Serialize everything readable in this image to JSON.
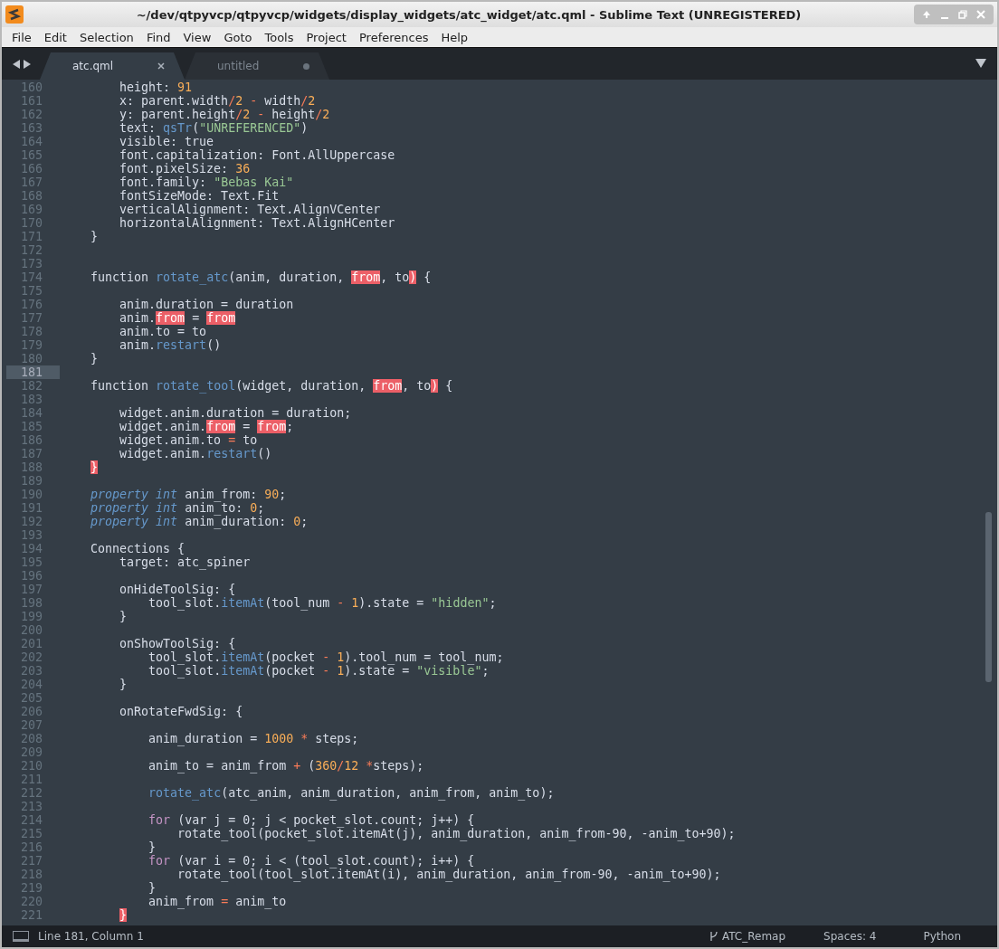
{
  "window": {
    "title": "~/dev/qtpyvcp/qtpyvcp/widgets/display_widgets/atc_widget/atc.qml - Sublime Text (UNREGISTERED)"
  },
  "menu": [
    "File",
    "Edit",
    "Selection",
    "Find",
    "View",
    "Goto",
    "Tools",
    "Project",
    "Preferences",
    "Help"
  ],
  "tabs": [
    {
      "label": "atc.qml",
      "selected": true,
      "modified": false
    },
    {
      "label": "untitled",
      "selected": false,
      "modified": true
    }
  ],
  "lines": [
    {
      "number": "160",
      "selected": false,
      "tokens": [
        {
          "text": "        height: ",
          "kind": "plain"
        },
        {
          "text": "91",
          "kind": "number"
        }
      ]
    },
    {
      "number": "161",
      "selected": false,
      "tokens": [
        {
          "text": "        x: parent.width",
          "kind": "plain"
        },
        {
          "text": "/",
          "kind": "operator"
        },
        {
          "text": "2",
          "kind": "number"
        },
        {
          "text": " -",
          "kind": "operator"
        },
        {
          "text": " width",
          "kind": "plain"
        },
        {
          "text": "/",
          "kind": "operator"
        },
        {
          "text": "2",
          "kind": "number"
        }
      ]
    },
    {
      "number": "162",
      "selected": false,
      "tokens": [
        {
          "text": "        y: parent.height",
          "kind": "plain"
        },
        {
          "text": "/",
          "kind": "operator"
        },
        {
          "text": "2",
          "kind": "number"
        },
        {
          "text": " -",
          "kind": "operator"
        },
        {
          "text": " height",
          "kind": "plain"
        },
        {
          "text": "/",
          "kind": "operator"
        },
        {
          "text": "2",
          "kind": "number"
        }
      ]
    },
    {
      "number": "163",
      "selected": false,
      "tokens": [
        {
          "text": "        text: ",
          "kind": "plain"
        },
        {
          "text": "qsTr",
          "kind": "func"
        },
        {
          "text": "(",
          "kind": "plain"
        },
        {
          "text": "\"UNREFERENCED\"",
          "kind": "string"
        },
        {
          "text": ")",
          "kind": "plain"
        }
      ]
    },
    {
      "number": "164",
      "selected": false,
      "tokens": [
        {
          "text": "        visible: true",
          "kind": "plain"
        }
      ]
    },
    {
      "number": "165",
      "selected": false,
      "tokens": [
        {
          "text": "        font.capitalization: Font.AllUppercase",
          "kind": "plain"
        }
      ]
    },
    {
      "number": "166",
      "selected": false,
      "tokens": [
        {
          "text": "        font.pixelSize: ",
          "kind": "plain"
        },
        {
          "text": "36",
          "kind": "number"
        }
      ]
    },
    {
      "number": "167",
      "selected": false,
      "tokens": [
        {
          "text": "        font.family: ",
          "kind": "plain"
        },
        {
          "text": "\"Bebas Kai\"",
          "kind": "string"
        }
      ]
    },
    {
      "number": "168",
      "selected": false,
      "tokens": [
        {
          "text": "        fontSizeMode: Text.Fit",
          "kind": "plain"
        }
      ]
    },
    {
      "number": "169",
      "selected": false,
      "tokens": [
        {
          "text": "        verticalAlignment: Text.AlignVCenter",
          "kind": "plain"
        }
      ]
    },
    {
      "number": "170",
      "selected": false,
      "tokens": [
        {
          "text": "        horizontalAlignment: Text.AlignHCenter",
          "kind": "plain"
        }
      ]
    },
    {
      "number": "171",
      "selected": false,
      "tokens": [
        {
          "text": "    }",
          "kind": "plain"
        }
      ]
    },
    {
      "number": "172",
      "selected": false
    },
    {
      "number": "173",
      "selected": false
    },
    {
      "number": "174",
      "selected": false,
      "tokens": [
        {
          "text": "    function ",
          "kind": "plain"
        },
        {
          "text": "rotate_atc",
          "kind": "func"
        },
        {
          "text": "(anim, duration, ",
          "kind": "plain"
        },
        {
          "text": "from",
          "kind": "invalid"
        },
        {
          "text": ", to",
          "kind": "plain"
        },
        {
          "text": ")",
          "kind": "invalid"
        },
        {
          "text": " {",
          "kind": "plain"
        }
      ]
    },
    {
      "number": "175",
      "selected": false
    },
    {
      "number": "176",
      "selected": false,
      "tokens": [
        {
          "text": "        anim.duration = duration",
          "kind": "plain"
        }
      ]
    },
    {
      "number": "177",
      "selected": false,
      "tokens": [
        {
          "text": "        anim.",
          "kind": "plain"
        },
        {
          "text": "from",
          "kind": "invalid"
        },
        {
          "text": " = ",
          "kind": "plain"
        },
        {
          "text": "from",
          "kind": "invalid"
        }
      ]
    },
    {
      "number": "178",
      "selected": false,
      "tokens": [
        {
          "text": "        anim.to = to",
          "kind": "plain"
        }
      ]
    },
    {
      "number": "179",
      "selected": false,
      "tokens": [
        {
          "text": "        anim.",
          "kind": "plain"
        },
        {
          "text": "restart",
          "kind": "func"
        },
        {
          "text": "()",
          "kind": "plain"
        }
      ]
    },
    {
      "number": "180",
      "selected": false,
      "tokens": [
        {
          "text": "    }",
          "kind": "plain"
        }
      ]
    },
    {
      "number": "181",
      "selected": true
    },
    {
      "number": "182",
      "selected": false,
      "tokens": [
        {
          "text": "    function ",
          "kind": "plain"
        },
        {
          "text": "rotate_tool",
          "kind": "func"
        },
        {
          "text": "(widget, duration, ",
          "kind": "plain"
        },
        {
          "text": "from",
          "kind": "invalid"
        },
        {
          "text": ", to",
          "kind": "plain"
        },
        {
          "text": ")",
          "kind": "invalid"
        },
        {
          "text": " {",
          "kind": "plain"
        }
      ]
    },
    {
      "number": "183",
      "selected": false
    },
    {
      "number": "184",
      "selected": false,
      "tokens": [
        {
          "text": "        widget.anim.duration = duration;",
          "kind": "plain"
        }
      ]
    },
    {
      "number": "185",
      "selected": false,
      "tokens": [
        {
          "text": "        widget.anim.",
          "kind": "plain"
        },
        {
          "text": "from",
          "kind": "invalid"
        },
        {
          "text": " = ",
          "kind": "plain"
        },
        {
          "text": "from",
          "kind": "invalid"
        },
        {
          "text": ";",
          "kind": "plain"
        }
      ]
    },
    {
      "number": "186",
      "selected": false,
      "tokens": [
        {
          "text": "        widget.anim.to ",
          "kind": "plain"
        },
        {
          "text": "=",
          "kind": "operator"
        },
        {
          "text": " to",
          "kind": "plain"
        }
      ]
    },
    {
      "number": "187",
      "selected": false,
      "tokens": [
        {
          "text": "        widget.anim.",
          "kind": "plain"
        },
        {
          "text": "restart",
          "kind": "func"
        },
        {
          "text": "()",
          "kind": "plain"
        }
      ]
    },
    {
      "number": "188",
      "selected": false,
      "tokens": [
        {
          "text": "    }",
          "kind": "invalid"
        }
      ]
    },
    {
      "number": "189",
      "selected": false
    },
    {
      "number": "190",
      "selected": false,
      "tokens": [
        {
          "text": "    property int",
          "kind": "storage"
        },
        {
          "text": " anim_from: ",
          "kind": "plain"
        },
        {
          "text": "90",
          "kind": "number"
        },
        {
          "text": ";",
          "kind": "plain"
        }
      ]
    },
    {
      "number": "191",
      "selected": false,
      "tokens": [
        {
          "text": "    property int",
          "kind": "storage"
        },
        {
          "text": " anim_to: ",
          "kind": "plain"
        },
        {
          "text": "0",
          "kind": "number"
        },
        {
          "text": ";",
          "kind": "plain"
        }
      ]
    },
    {
      "number": "192",
      "selected": false,
      "tokens": [
        {
          "text": "    property int",
          "kind": "storage"
        },
        {
          "text": " anim_duration: ",
          "kind": "plain"
        },
        {
          "text": "0",
          "kind": "number"
        },
        {
          "text": ";",
          "kind": "plain"
        }
      ]
    },
    {
      "number": "193",
      "selected": false
    },
    {
      "number": "194",
      "selected": false,
      "tokens": [
        {
          "text": "    Connections {",
          "kind": "plain"
        }
      ]
    },
    {
      "number": "195",
      "selected": false,
      "tokens": [
        {
          "text": "        target: atc_spiner",
          "kind": "plain"
        }
      ]
    },
    {
      "number": "196",
      "selected": false
    },
    {
      "number": "197",
      "selected": false,
      "tokens": [
        {
          "text": "        onHideToolSig: {",
          "kind": "plain"
        }
      ]
    },
    {
      "number": "198",
      "selected": false,
      "tokens": [
        {
          "text": "            tool_slot.",
          "kind": "plain"
        },
        {
          "text": "itemAt",
          "kind": "func"
        },
        {
          "text": "(tool_num ",
          "kind": "plain"
        },
        {
          "text": "-",
          "kind": "operator"
        },
        {
          "text": " 1",
          "kind": "number"
        },
        {
          "text": ").state = ",
          "kind": "plain"
        },
        {
          "text": "\"hidden\"",
          "kind": "string"
        },
        {
          "text": ";",
          "kind": "plain"
        }
      ]
    },
    {
      "number": "199",
      "selected": false,
      "tokens": [
        {
          "text": "        }",
          "kind": "plain"
        }
      ]
    },
    {
      "number": "200",
      "selected": false
    },
    {
      "number": "201",
      "selected": false,
      "tokens": [
        {
          "text": "        onShowToolSig: {",
          "kind": "plain"
        }
      ]
    },
    {
      "number": "202",
      "selected": false,
      "tokens": [
        {
          "text": "            tool_slot.",
          "kind": "plain"
        },
        {
          "text": "itemAt",
          "kind": "func"
        },
        {
          "text": "(pocket ",
          "kind": "plain"
        },
        {
          "text": "-",
          "kind": "operator"
        },
        {
          "text": " 1",
          "kind": "number"
        },
        {
          "text": ").tool_num = tool_num;",
          "kind": "plain"
        }
      ]
    },
    {
      "number": "203",
      "selected": false,
      "tokens": [
        {
          "text": "            tool_slot.",
          "kind": "plain"
        },
        {
          "text": "itemAt",
          "kind": "func"
        },
        {
          "text": "(pocket ",
          "kind": "plain"
        },
        {
          "text": "-",
          "kind": "operator"
        },
        {
          "text": " 1",
          "kind": "number"
        },
        {
          "text": ").state = ",
          "kind": "plain"
        },
        {
          "text": "\"visible\"",
          "kind": "string"
        },
        {
          "text": ";",
          "kind": "plain"
        }
      ]
    },
    {
      "number": "204",
      "selected": false,
      "tokens": [
        {
          "text": "        }",
          "kind": "plain"
        }
      ]
    },
    {
      "number": "205",
      "selected": false
    },
    {
      "number": "206",
      "selected": false,
      "tokens": [
        {
          "text": "        onRotateFwdSig: {",
          "kind": "plain"
        }
      ]
    },
    {
      "number": "207",
      "selected": false
    },
    {
      "number": "208",
      "selected": false,
      "tokens": [
        {
          "text": "            anim_duration = ",
          "kind": "plain"
        },
        {
          "text": "1000",
          "kind": "number"
        },
        {
          "text": " *",
          "kind": "operator"
        },
        {
          "text": " steps;",
          "kind": "plain"
        }
      ]
    },
    {
      "number": "209",
      "selected": false
    },
    {
      "number": "210",
      "selected": false,
      "tokens": [
        {
          "text": "            anim_to = anim_from ",
          "kind": "plain"
        },
        {
          "text": "+",
          "kind": "operator"
        },
        {
          "text": " (",
          "kind": "plain"
        },
        {
          "text": "360",
          "kind": "number"
        },
        {
          "text": "/",
          "kind": "operator"
        },
        {
          "text": "12",
          "kind": "number"
        },
        {
          "text": " *",
          "kind": "operator"
        },
        {
          "text": "steps);",
          "kind": "plain"
        }
      ]
    },
    {
      "number": "211",
      "selected": false
    },
    {
      "number": "212",
      "selected": false,
      "tokens": [
        {
          "text": "            rotate_atc",
          "kind": "func"
        },
        {
          "text": "(atc_anim, anim_duration, anim_from, anim_to);",
          "kind": "plain"
        }
      ]
    },
    {
      "number": "213",
      "selected": false
    },
    {
      "number": "214",
      "selected": false,
      "tokens": [
        {
          "text": "            for",
          "kind": "control"
        },
        {
          "text": " (var j = 0; j < pocket_slot.count; j++) {",
          "kind": "plain"
        }
      ]
    },
    {
      "number": "215",
      "selected": false,
      "tokens": [
        {
          "text": "                rotate_tool(pocket_slot.itemAt(j), anim_duration, anim_from-90, -anim_to+90);",
          "kind": "plain"
        }
      ]
    },
    {
      "number": "216",
      "selected": false,
      "tokens": [
        {
          "text": "            }",
          "kind": "plain"
        }
      ]
    },
    {
      "number": "217",
      "selected": false,
      "tokens": [
        {
          "text": "            for",
          "kind": "control"
        },
        {
          "text": " (var i = 0; i < (tool_slot.count); i++) {",
          "kind": "plain"
        }
      ]
    },
    {
      "number": "218",
      "selected": false,
      "tokens": [
        {
          "text": "                rotate_tool(tool_slot.itemAt(i), anim_duration, anim_from-90, -anim_to+90);",
          "kind": "plain"
        }
      ]
    },
    {
      "number": "219",
      "selected": false,
      "tokens": [
        {
          "text": "            }",
          "kind": "plain"
        }
      ]
    },
    {
      "number": "220",
      "selected": false,
      "tokens": [
        {
          "text": "            anim_from ",
          "kind": "plain"
        },
        {
          "text": "=",
          "kind": "operator"
        },
        {
          "text": " anim_to",
          "kind": "plain"
        }
      ]
    },
    {
      "number": "221",
      "selected": false,
      "tokens": [
        {
          "text": "        }",
          "kind": "invalid"
        }
      ]
    }
  ],
  "status_bar": {
    "position": "Line 181, Column 1",
    "branch": "ATC_Remap",
    "indentation": "Spaces: 4",
    "syntax": "Python"
  }
}
